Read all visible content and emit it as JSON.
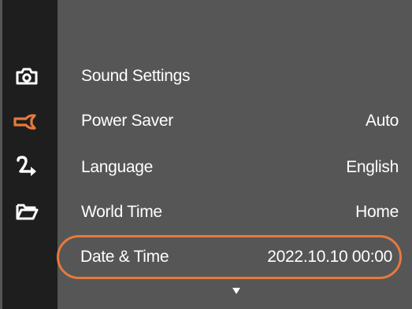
{
  "colors": {
    "background": "#565656",
    "sidebar": "#1e1e1e",
    "accent": "#e57a3c",
    "icon_default": "#ffffff",
    "text": "#ffffff"
  },
  "sidebar": {
    "tabs": [
      {
        "icon": "camera-icon",
        "active": false
      },
      {
        "icon": "wrench-icon",
        "active": true
      },
      {
        "icon": "playback-arrow-icon",
        "active": false
      },
      {
        "icon": "folder-icon",
        "active": false
      }
    ]
  },
  "menu": {
    "items": [
      {
        "label": "Sound Settings",
        "value": ""
      },
      {
        "label": "Power Saver",
        "value": "Auto"
      },
      {
        "label": "Language",
        "value": "English"
      },
      {
        "label": "World Time",
        "value": "Home"
      },
      {
        "label": "Date & Time",
        "value": "2022.10.10 00:00",
        "selected": true
      }
    ],
    "more_indicator": "down-arrow-icon"
  }
}
